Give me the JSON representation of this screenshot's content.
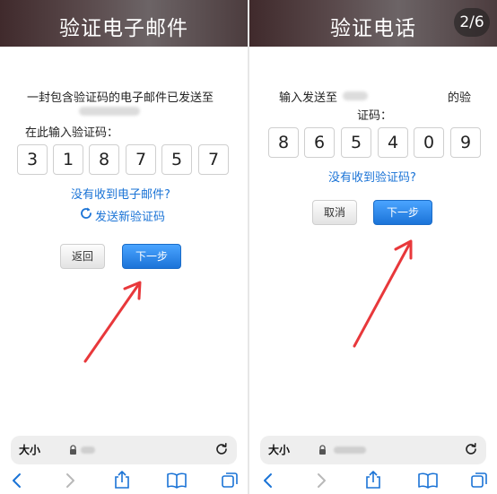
{
  "left": {
    "header_title": "验证电子邮件",
    "message": "一封包含验证码的电子邮件已发送至",
    "prompt": "在此输入验证码：",
    "code": [
      "3",
      "1",
      "8",
      "7",
      "5",
      "7"
    ],
    "not_received": "没有收到电子邮件?",
    "resend": "发送新验证码",
    "back_button": "返回",
    "next_button": "下一步"
  },
  "right": {
    "header_title": "验证电话",
    "page_counter": "2/6",
    "message_part1": "输入发送至",
    "message_part2": "的验",
    "message_part3": "证码：",
    "code": [
      "8",
      "6",
      "5",
      "4",
      "0",
      "9"
    ],
    "not_received": "没有收到验证码?",
    "cancel_button": "取消",
    "next_button": "下一步"
  },
  "browser": {
    "text_size_label": "大小"
  },
  "colors": {
    "link": "#1a73d6",
    "primary_button": "#1b73d8",
    "arrow": "#e8383b"
  }
}
